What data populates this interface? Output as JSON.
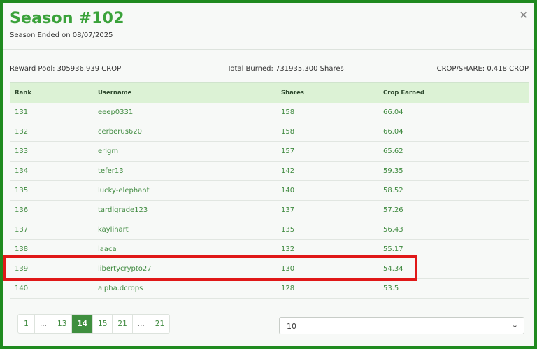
{
  "header": {
    "title": "Season #102",
    "subtitle": "Season Ended on 08/07/2025",
    "close_glyph": "×"
  },
  "stats": {
    "reward_pool": "Reward Pool: 305936.939 CROP",
    "total_burned": "Total Burned: 731935.300 Shares",
    "crop_per_share": "CROP/SHARE: 0.418 CROP"
  },
  "table": {
    "columns": [
      "Rank",
      "Username",
      "Shares",
      "Crop Earned"
    ],
    "rows": [
      {
        "rank": "131",
        "username": "eeep0331",
        "shares": "158",
        "crop": "66.04"
      },
      {
        "rank": "132",
        "username": "cerberus620",
        "shares": "158",
        "crop": "66.04"
      },
      {
        "rank": "133",
        "username": "erigm",
        "shares": "157",
        "crop": "65.62"
      },
      {
        "rank": "134",
        "username": "tefer13",
        "shares": "142",
        "crop": "59.35"
      },
      {
        "rank": "135",
        "username": "lucky-elephant",
        "shares": "140",
        "crop": "58.52"
      },
      {
        "rank": "136",
        "username": "tardigrade123",
        "shares": "137",
        "crop": "57.26"
      },
      {
        "rank": "137",
        "username": "kaylinart",
        "shares": "135",
        "crop": "56.43"
      },
      {
        "rank": "138",
        "username": "laaca",
        "shares": "132",
        "crop": "55.17"
      },
      {
        "rank": "139",
        "username": "libertycrypto27",
        "shares": "130",
        "crop": "54.34"
      },
      {
        "rank": "140",
        "username": "alpha.dcrops",
        "shares": "128",
        "crop": "53.5"
      }
    ]
  },
  "pagination": {
    "items": [
      "1",
      "...",
      "13",
      "14",
      "15",
      "21",
      "...",
      "21"
    ],
    "active": "14"
  },
  "page_size": {
    "selected": "10",
    "chevron": "⌄"
  },
  "colors": {
    "accent": "#3aa23a",
    "frame": "#1f8a1f",
    "header_row": "#dcf2d5",
    "highlight": "#e01818"
  }
}
